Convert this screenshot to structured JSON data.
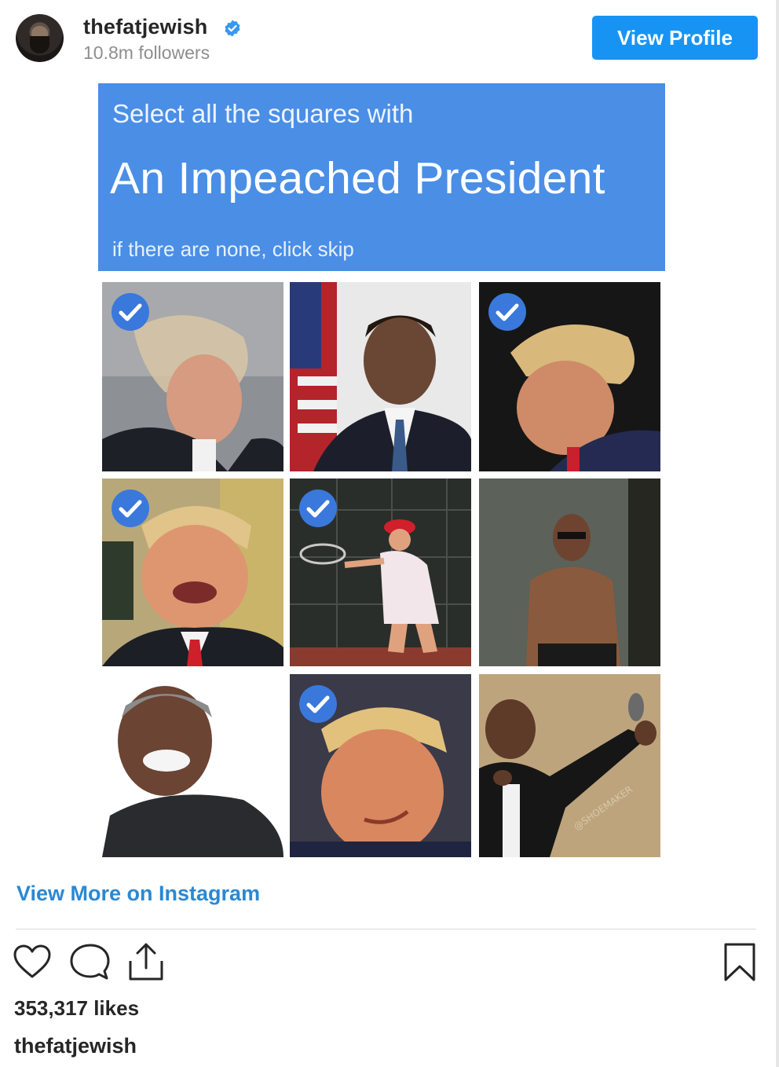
{
  "profile": {
    "username": "thefatjewish",
    "followers": "10.8m followers",
    "view_profile_label": "View Profile"
  },
  "post": {
    "captcha_line1": "Select all the squares with",
    "captcha_line2": "An Impeached President",
    "captcha_line3": "if there are none, click skip",
    "tiles": [
      {
        "subject": "windswept hair portrait",
        "selected": true
      },
      {
        "subject": "portrait with flag",
        "selected": false
      },
      {
        "subject": "downcast profile portrait",
        "selected": true
      },
      {
        "subject": "laughing portrait",
        "selected": true
      },
      {
        "subject": "tennis player in red cap",
        "selected": true
      },
      {
        "subject": "shirtless man in sunglasses",
        "selected": false
      },
      {
        "subject": "smiling man in jacket",
        "selected": false
      },
      {
        "subject": "smirking close-up",
        "selected": true
      },
      {
        "subject": "mic drop",
        "selected": false
      }
    ],
    "watermark": "@SHOEMAKER"
  },
  "footer": {
    "view_more_label": "View More on Instagram",
    "likes": "353,317 likes",
    "caption_username": "thefatjewish"
  },
  "colors": {
    "accent_blue": "#1794f3",
    "link_blue": "#2a88d3",
    "captcha_blue": "#4a8ee6",
    "check_blue": "#3a78db"
  },
  "icons": [
    "heart-icon",
    "comment-icon",
    "share-icon",
    "bookmark-icon",
    "verified-badge-icon"
  ]
}
